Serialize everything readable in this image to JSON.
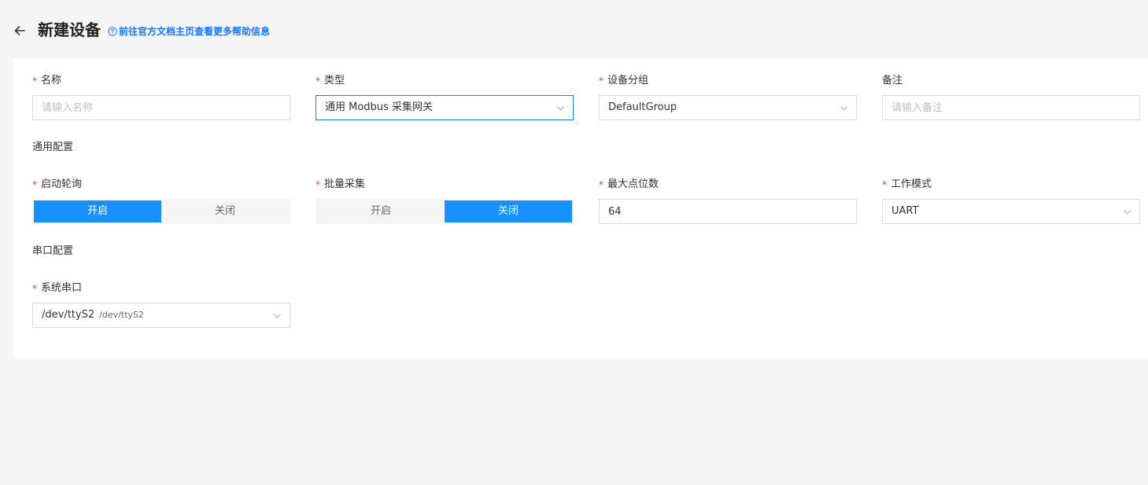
{
  "header": {
    "title": "新建设备",
    "help_link": "前往官方文档主页查看更多帮助信息"
  },
  "basic": {
    "name": {
      "label": "名称",
      "placeholder": "请输入名称",
      "value": ""
    },
    "type": {
      "label": "类型",
      "value": "通用 Modbus 采集网关"
    },
    "group": {
      "label": "设备分组",
      "value": "DefaultGroup"
    },
    "remark": {
      "label": "备注",
      "placeholder": "请输入备注",
      "value": ""
    }
  },
  "general_config": {
    "title": "通用配置",
    "polling": {
      "label": "启动轮询",
      "on": "开启",
      "off": "关闭",
      "selected": "on"
    },
    "batch": {
      "label": "批量采集",
      "on": "开启",
      "off": "关闭",
      "selected": "off"
    },
    "max_points": {
      "label": "最大点位数",
      "value": "64"
    },
    "work_mode": {
      "label": "工作模式",
      "value": "UART"
    }
  },
  "serial_config": {
    "title": "串口配置",
    "port": {
      "label": "系统串口",
      "value": "/dev/ttyS2",
      "sub": "/dev/ttyS2"
    }
  },
  "colors": {
    "accent": "#1890ff",
    "link": "#1677ff",
    "required": "#e53935"
  }
}
